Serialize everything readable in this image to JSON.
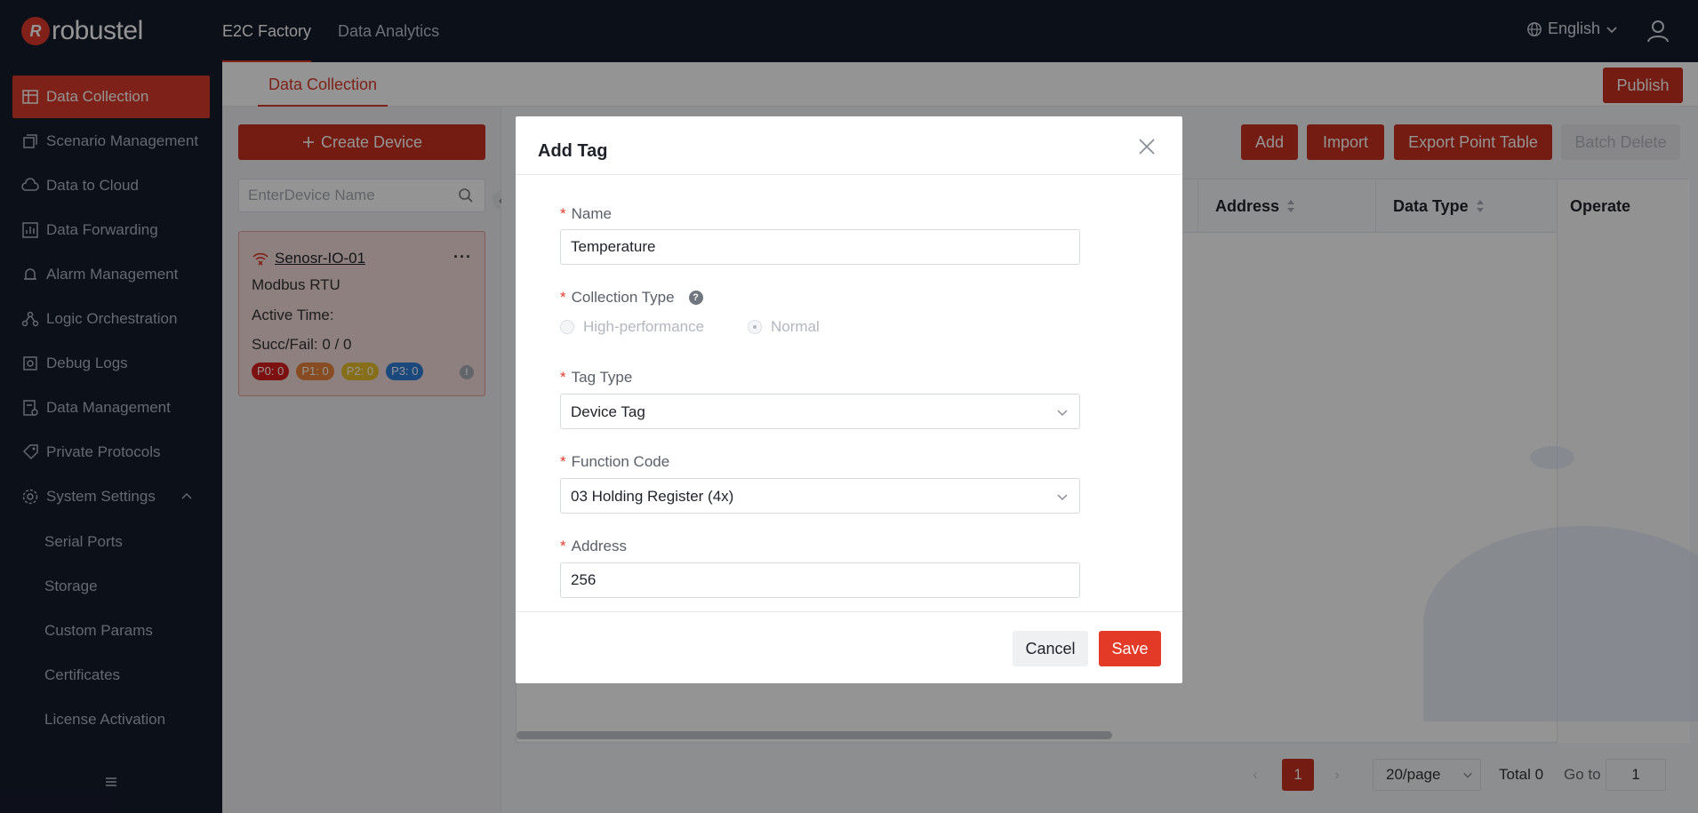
{
  "brand": {
    "logo_text": "robustel",
    "logo_mark": "R"
  },
  "topnav": {
    "items": [
      {
        "label": "E2C Factory"
      },
      {
        "label": "Data Analytics"
      }
    ]
  },
  "header": {
    "language": "English"
  },
  "sidebar": {
    "items": [
      {
        "label": "Data Collection",
        "icon": "data-collection-icon"
      },
      {
        "label": "Scenario Management",
        "icon": "scenario-icon"
      },
      {
        "label": "Data to Cloud",
        "icon": "cloud-icon"
      },
      {
        "label": "Data Forwarding",
        "icon": "forwarding-icon"
      },
      {
        "label": "Alarm Management",
        "icon": "alarm-icon"
      },
      {
        "label": "Logic Orchestration",
        "icon": "logic-icon"
      },
      {
        "label": "Debug Logs",
        "icon": "debug-icon"
      },
      {
        "label": "Data Management",
        "icon": "database-icon"
      },
      {
        "label": "Private Protocols",
        "icon": "protocol-icon"
      },
      {
        "label": "System Settings",
        "icon": "gear-icon"
      }
    ],
    "sub_items": [
      {
        "label": "Serial Ports"
      },
      {
        "label": "Storage"
      },
      {
        "label": "Custom Params"
      },
      {
        "label": "Certificates"
      },
      {
        "label": "License Activation"
      }
    ]
  },
  "main": {
    "subtab": "Data Collection",
    "publish_label": "Publish",
    "create_device_label": "Create Device",
    "search_placeholder": "EnterDevice Name",
    "device": {
      "name": "Senosr-IO-01",
      "protocol": "Modbus RTU",
      "active_time": "Active Time:",
      "succ_fail": "Succ/Fail:  0 / 0",
      "badges": [
        {
          "label": "P0: 0",
          "color": "#d81e1e"
        },
        {
          "label": "P1: 0",
          "color": "#e8833a"
        },
        {
          "label": "P2: 0",
          "color": "#e9c02e"
        },
        {
          "label": "P3: 0",
          "color": "#2f7fd8"
        }
      ]
    },
    "toolbar": {
      "add": "Add",
      "import": "Import",
      "export": "Export Point Table",
      "batch_delete": "Batch Delete"
    },
    "table": {
      "columns": [
        "Address",
        "Data Type",
        "Operate"
      ]
    },
    "pagination": {
      "current_page": "1",
      "page_size": "20/page",
      "total": "Total 0",
      "goto_label": "Go to",
      "goto_value": "1"
    }
  },
  "modal": {
    "title": "Add Tag",
    "name_label": "Name",
    "name_value": "Temperature",
    "collection_type_label": "Collection Type",
    "collection_options": [
      "High-performance",
      "Normal"
    ],
    "tag_type_label": "Tag Type",
    "tag_type_value": "Device Tag",
    "function_code_label": "Function Code",
    "function_code_value": "03 Holding Register (4x)",
    "address_label": "Address",
    "address_value": "256",
    "required_mark": "*",
    "help_mark": "?",
    "cancel_label": "Cancel",
    "save_label": "Save"
  },
  "colors": {
    "accent": "#d93a2b",
    "sidebar_bg": "#161c2c",
    "topbar_bg": "#161c2c"
  }
}
